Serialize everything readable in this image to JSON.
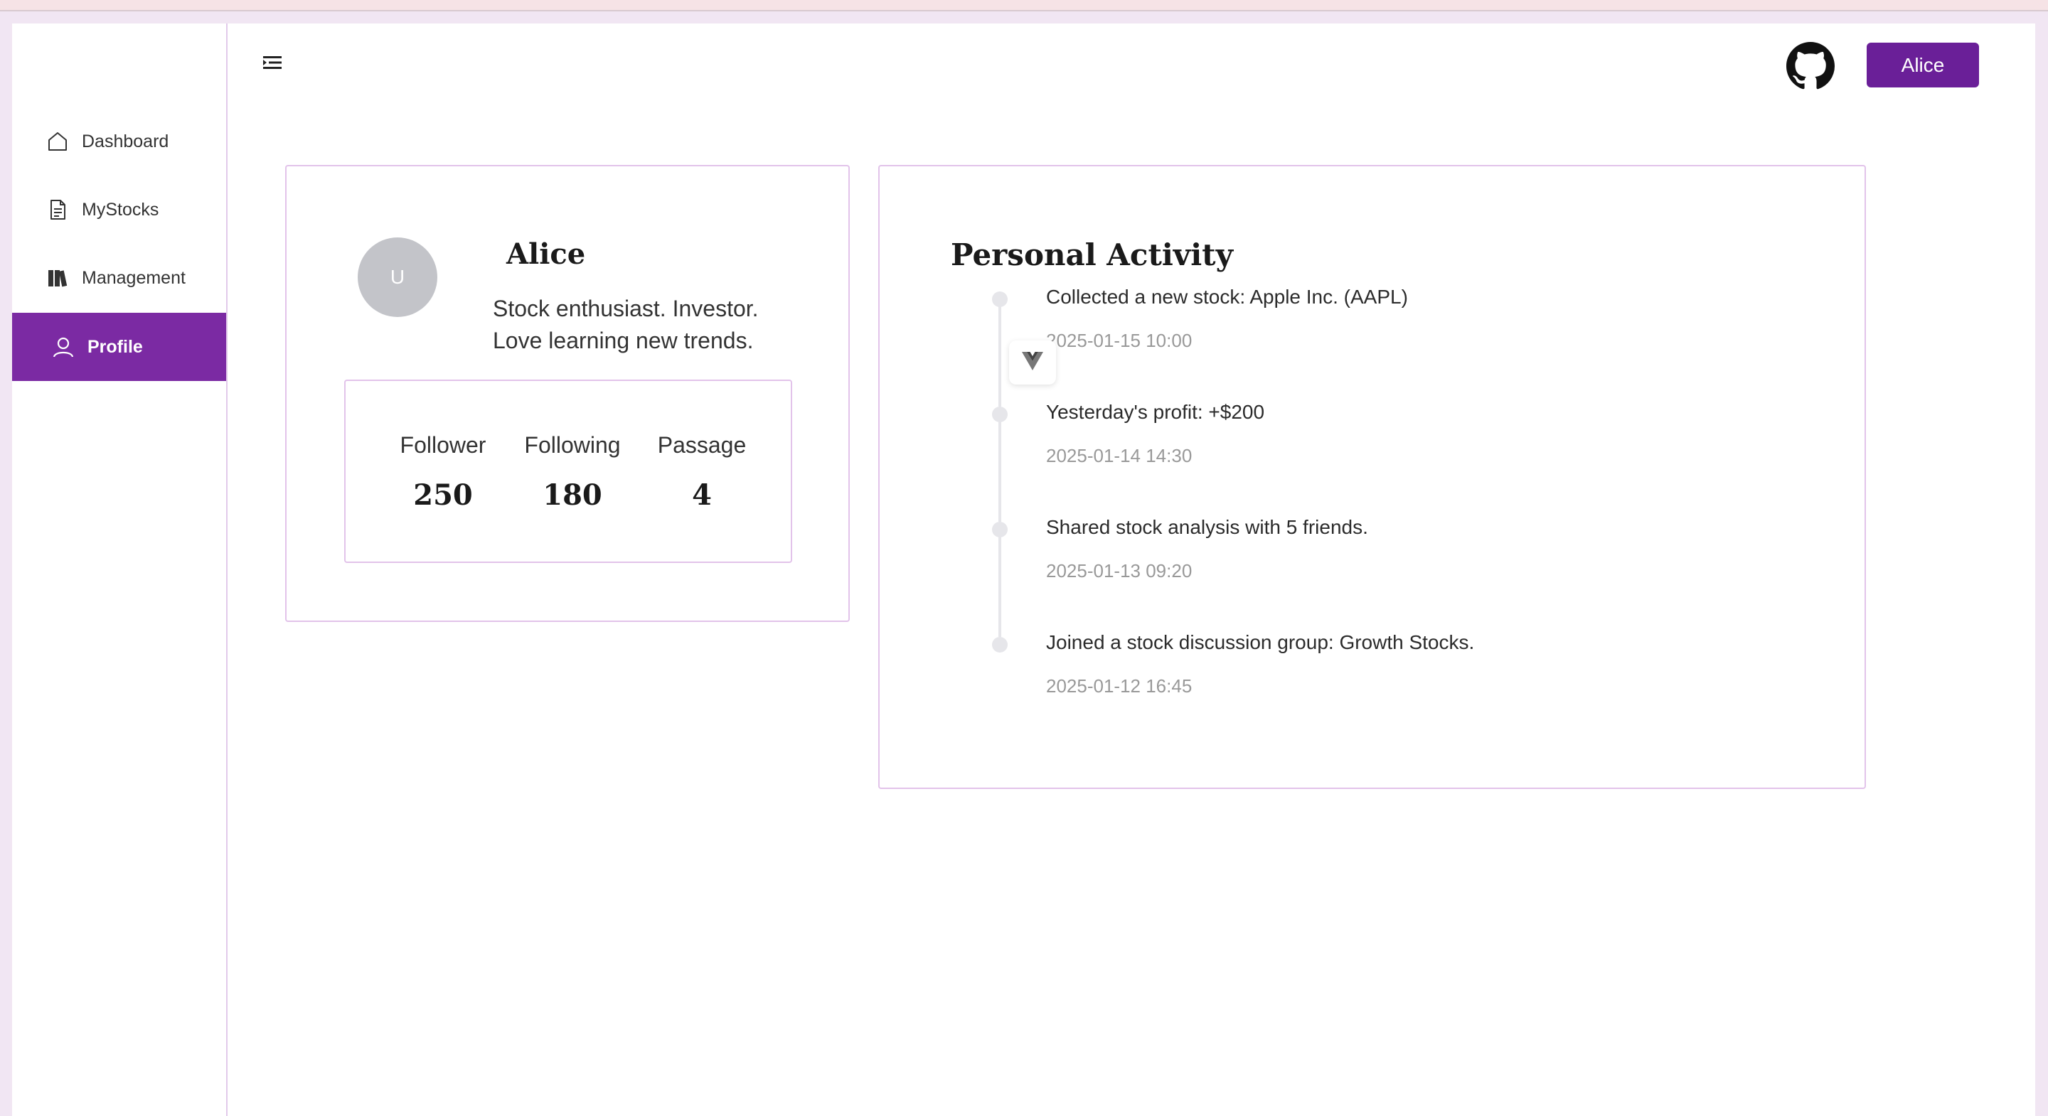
{
  "sidebar": {
    "items": [
      {
        "label": "Dashboard",
        "icon": "home-icon"
      },
      {
        "label": "MyStocks",
        "icon": "document-icon"
      },
      {
        "label": "Management",
        "icon": "books-icon"
      },
      {
        "label": "Profile",
        "icon": "user-icon",
        "active": true
      }
    ]
  },
  "header": {
    "user_button": "Alice",
    "github_icon": "github-icon",
    "menu_icon": "menu-collapse-icon"
  },
  "profile": {
    "avatar_initial": "U",
    "name": "Alice",
    "bio": "Stock enthusiast. Investor. Love learning new trends.",
    "stats": [
      {
        "label": "Follower",
        "value": "250"
      },
      {
        "label": "Following",
        "value": "180"
      },
      {
        "label": "Passage",
        "value": "4"
      }
    ]
  },
  "activity": {
    "title": "Personal Activity",
    "items": [
      {
        "text": "Collected a new stock: Apple Inc. (AAPL)",
        "time": "2025-01-15 10:00"
      },
      {
        "text": "Yesterday's profit: +$200",
        "time": "2025-01-14 14:30"
      },
      {
        "text": "Shared stock analysis with 5 friends.",
        "time": "2025-01-13 09:20"
      },
      {
        "text": "Joined a stock discussion group: Growth Stocks.",
        "time": "2025-01-12 16:45"
      }
    ]
  },
  "colors": {
    "accent": "#7b2aa3",
    "button": "#6a1f98",
    "border": "#e2c3ea",
    "background": "#f1e6f3"
  }
}
